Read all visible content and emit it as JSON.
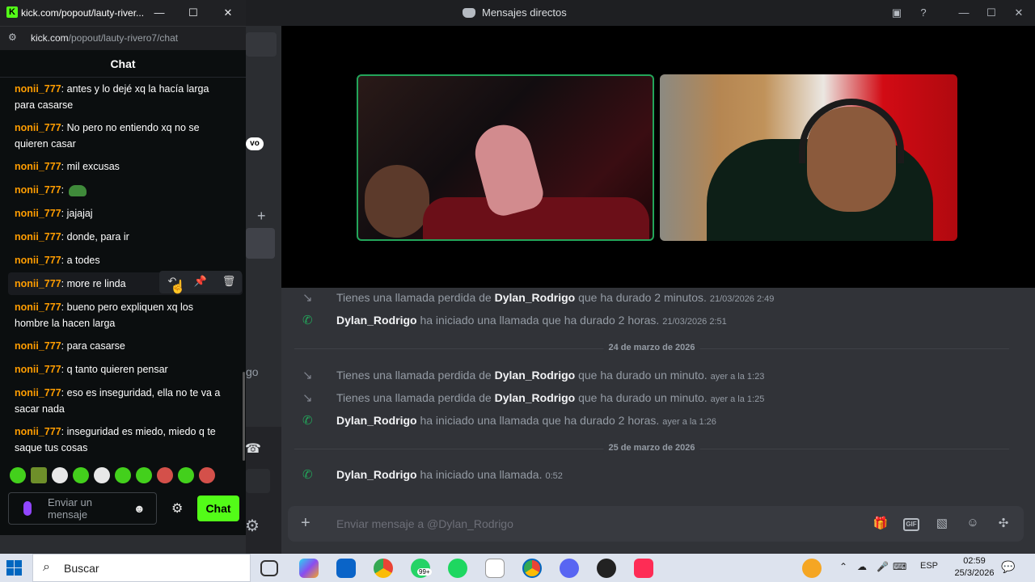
{
  "discord": {
    "window_title": "Mensajes directos",
    "left_pill": "vo",
    "left_fragment": "go",
    "call_log_top": [
      {
        "type": "missed",
        "pre": "Tienes una llamada perdida de",
        "user": "Dylan_Rodrigo",
        "post": "que ha durado 2 minutos.",
        "ts": "21/03/2026 2:49"
      },
      {
        "type": "ok",
        "pre": "",
        "user": "Dylan_Rodrigo",
        "post": "ha iniciado una llamada que ha durado 2 horas.",
        "ts": "21/03/2026 2:51"
      }
    ],
    "divider_1": "24 de marzo de 2026",
    "call_log_mid": [
      {
        "type": "missed",
        "pre": "Tienes una llamada perdida de",
        "user": "Dylan_Rodrigo",
        "post": "que ha durado un minuto.",
        "ts": "ayer a la 1:23"
      },
      {
        "type": "missed",
        "pre": "Tienes una llamada perdida de",
        "user": "Dylan_Rodrigo",
        "post": "que ha durado un minuto.",
        "ts": "ayer a la 1:25"
      },
      {
        "type": "ok",
        "pre": "",
        "user": "Dylan_Rodrigo",
        "post": "ha iniciado una llamada que ha durado 2 horas.",
        "ts": "ayer a la 1:26"
      }
    ],
    "divider_2": "25 de marzo de 2026",
    "call_log_bottom": [
      {
        "type": "ok",
        "pre": "",
        "user": "Dylan_Rodrigo",
        "post": "ha iniciado una llamada.",
        "ts": "0:52"
      }
    ],
    "composer_placeholder": "Enviar mensaje a @Dylan_Rodrigo",
    "composer_gif": "GIF"
  },
  "kick": {
    "window_title": "kick.com/popout/lauty-river...",
    "url_host": "kick.com",
    "url_path": "/popout/lauty-rivero7/chat",
    "chat_header": "Chat",
    "messages": [
      {
        "user": "nonii_777",
        "text": "antes y lo dejé xq la hacía larga para casarse"
      },
      {
        "user": "nonii_777",
        "text": "No pero no entiendo xq no se quieren casar"
      },
      {
        "user": "nonii_777",
        "text": "mil excusas"
      },
      {
        "user": "nonii_777",
        "text": ""
      },
      {
        "user": "nonii_777",
        "text": "jajajaj"
      },
      {
        "user": "nonii_777",
        "text": "donde, para ir"
      },
      {
        "user": "nonii_777",
        "text": "a todes"
      },
      {
        "user": "nonii_777",
        "text": "more re linda"
      },
      {
        "user": "nonii_777",
        "text": "bueno pero expliquen xq los hombre la hacen larga"
      },
      {
        "user": "nonii_777",
        "text": "para casarse"
      },
      {
        "user": "nonii_777",
        "text": "q tanto quieren pensar"
      },
      {
        "user": "nonii_777",
        "text": "eso es inseguridad, ella no te va a sacar nada"
      },
      {
        "user": "nonii_777",
        "text": "inseguridad es miedo, miedo q te saque tus cosas"
      }
    ],
    "input_placeholder": "Enviar un mensaje",
    "send_label": "Chat"
  },
  "taskbar": {
    "search_label": "Buscar",
    "whatsapp_badge": "99+",
    "language": "ESP",
    "time": "02:59",
    "date": "25/3/2026"
  },
  "colors": {
    "kick_green": "#53fc18",
    "username_orange": "#ff9d00",
    "discord_bg": "#313338",
    "call_green": "#23a55a"
  }
}
